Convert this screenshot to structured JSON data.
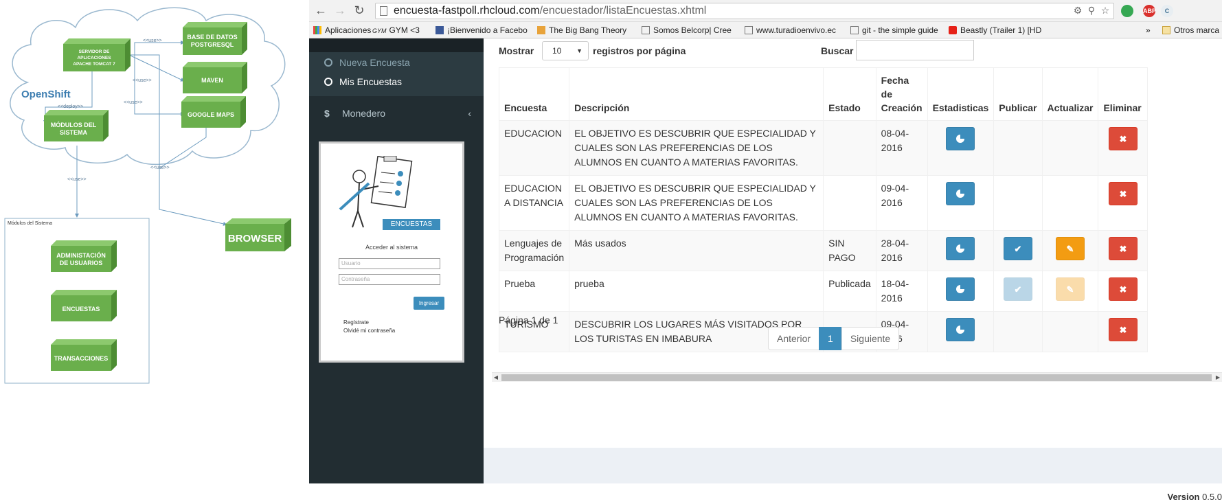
{
  "diagram": {
    "cloud_label": "OpenShift",
    "server_box": [
      "SERVIDOR DE",
      "APLICACIONES",
      "APACHE TOMCAT 7"
    ],
    "db_box": [
      "BASE DE DATOS",
      "POSTGRESQL"
    ],
    "maven_box": "MAVEN",
    "maps_box": "GOOGLE MAPS",
    "modules_box": [
      "MÓDULOS DEL",
      "SISTEMA"
    ],
    "browser_box": "BROWSER",
    "deploy_label": "<<deploy>>",
    "use_label": "<<use>>",
    "modules_panel_title": "Módulos del Sistema",
    "module_admin": [
      "ADMINISTACIÓN",
      "DE USUARIOS"
    ],
    "module_encuestas": "ENCUESTAS",
    "module_transacciones": "TRANSACCIONES",
    "colors": {
      "box_front": "#6aaf4c",
      "box_top": "#8cc96e",
      "box_side": "#4d8d33",
      "cloud_line": "#9ab8cf"
    }
  },
  "browser": {
    "url_domain": "encuesta-fastpoll.rhcloud.com",
    "url_path": "/encuestador/listaEncuestas.xhtml",
    "back_icon": "arrow-left-icon",
    "forward_icon": "arrow-right-icon",
    "reload_icon": "reload-icon",
    "bookmarks": [
      {
        "label": "Aplicaciones",
        "icon": "apps-grid-icon"
      },
      {
        "label": "GYM <3",
        "icon": "gym-icon"
      },
      {
        "label": "¡Bienvenido a Facebo",
        "icon": "facebook-icon"
      },
      {
        "label": "The Big Bang Theory",
        "icon": "tv-icon"
      },
      {
        "label": "Somos Belcorp| Cree",
        "icon": "page-icon"
      },
      {
        "label": "www.turadioenvivo.ec",
        "icon": "page-icon"
      },
      {
        "label": "git - the simple guide",
        "icon": "page-icon"
      },
      {
        "label": "Beastly (Trailer 1) [HD",
        "icon": "youtube-icon"
      }
    ],
    "overflow": "»",
    "other_bookmarks": "Otros marca"
  },
  "sidebar": {
    "items": [
      {
        "label": "Nueva Encuesta",
        "active": false
      },
      {
        "label": "Mis Encuestas",
        "active": true
      }
    ],
    "monedero_label": "Monedero",
    "monedero_icon": "dollar-icon",
    "login_preview": {
      "banner": "ENCUESTAS",
      "title": "Acceder al sistema",
      "user_placeholder": "Usuario",
      "pass_placeholder": "Contraseña",
      "button": "Ingresar",
      "register": "Regístrate",
      "forgot": "Olvidé mi contraseña"
    }
  },
  "table_controls": {
    "show_label": "Mostrar",
    "page_length": "10",
    "per_page_label": "registros por página",
    "search_label": "Buscar"
  },
  "table": {
    "headers": {
      "encuesta": "Encuesta",
      "descripcion": "Descripción",
      "estado": "Estado",
      "fecha": [
        "Fecha de",
        "Creación"
      ],
      "estadisticas": "Estadisticas",
      "publicar": "Publicar",
      "actualizar": "Actualizar",
      "eliminar": "Eliminar"
    },
    "rows": [
      {
        "encuesta": "EDUCACION",
        "descripcion": "EL OBJETIVO ES DESCUBRIR QUE ESPECIALIDAD Y CUALES SON LAS PREFERENCIAS DE LOS ALUMNOS EN CUANTO A MATERIAS FAVORITAS.",
        "estado": "",
        "fecha": [
          "08-04-",
          "2016"
        ],
        "publicar": "none",
        "actualizar": "none"
      },
      {
        "encuesta": "EDUCACION A DISTANCIA",
        "descripcion": "EL OBJETIVO ES DESCUBRIR QUE ESPECIALIDAD Y CUALES SON LAS PREFERENCIAS DE LOS ALUMNOS EN CUANTO A MATERIAS FAVORITAS.",
        "estado": "",
        "fecha": [
          "09-04-",
          "2016"
        ],
        "publicar": "none",
        "actualizar": "none"
      },
      {
        "encuesta": "Lenguajes de Programación",
        "descripcion": "Más usados",
        "estado": "SIN PAGO",
        "fecha": [
          "28-04-",
          "2016"
        ],
        "publicar": "enabled",
        "actualizar": "enabled"
      },
      {
        "encuesta": "Prueba",
        "descripcion": "prueba",
        "estado": "Publicada",
        "fecha": [
          "18-04-",
          "2016"
        ],
        "publicar": "disabled",
        "actualizar": "disabled"
      },
      {
        "encuesta": "TURISMO",
        "descripcion": "DESCUBRIR LOS LUGARES MÁS VISITADOS POR LOS TURISTAS EN IMBABURA",
        "estado": "",
        "fecha": [
          "09-04-",
          "2016"
        ],
        "publicar": "none",
        "actualizar": "none"
      }
    ],
    "icons": {
      "estadisticas": "pie-chart-icon",
      "publicar": "check-icon",
      "actualizar": "edit-icon",
      "eliminar": "close-icon"
    }
  },
  "pagination": {
    "info": "Página 1 de 1",
    "prev": "Anterior",
    "current": "1",
    "next": "Siguiente"
  },
  "footer": {
    "version_label": "Version",
    "version_value": "0.5.0"
  },
  "colors": {
    "primary": "#3c8dbc",
    "danger": "#dd4b39",
    "warning": "#f39c12",
    "sidebar_bg": "#222d32"
  }
}
